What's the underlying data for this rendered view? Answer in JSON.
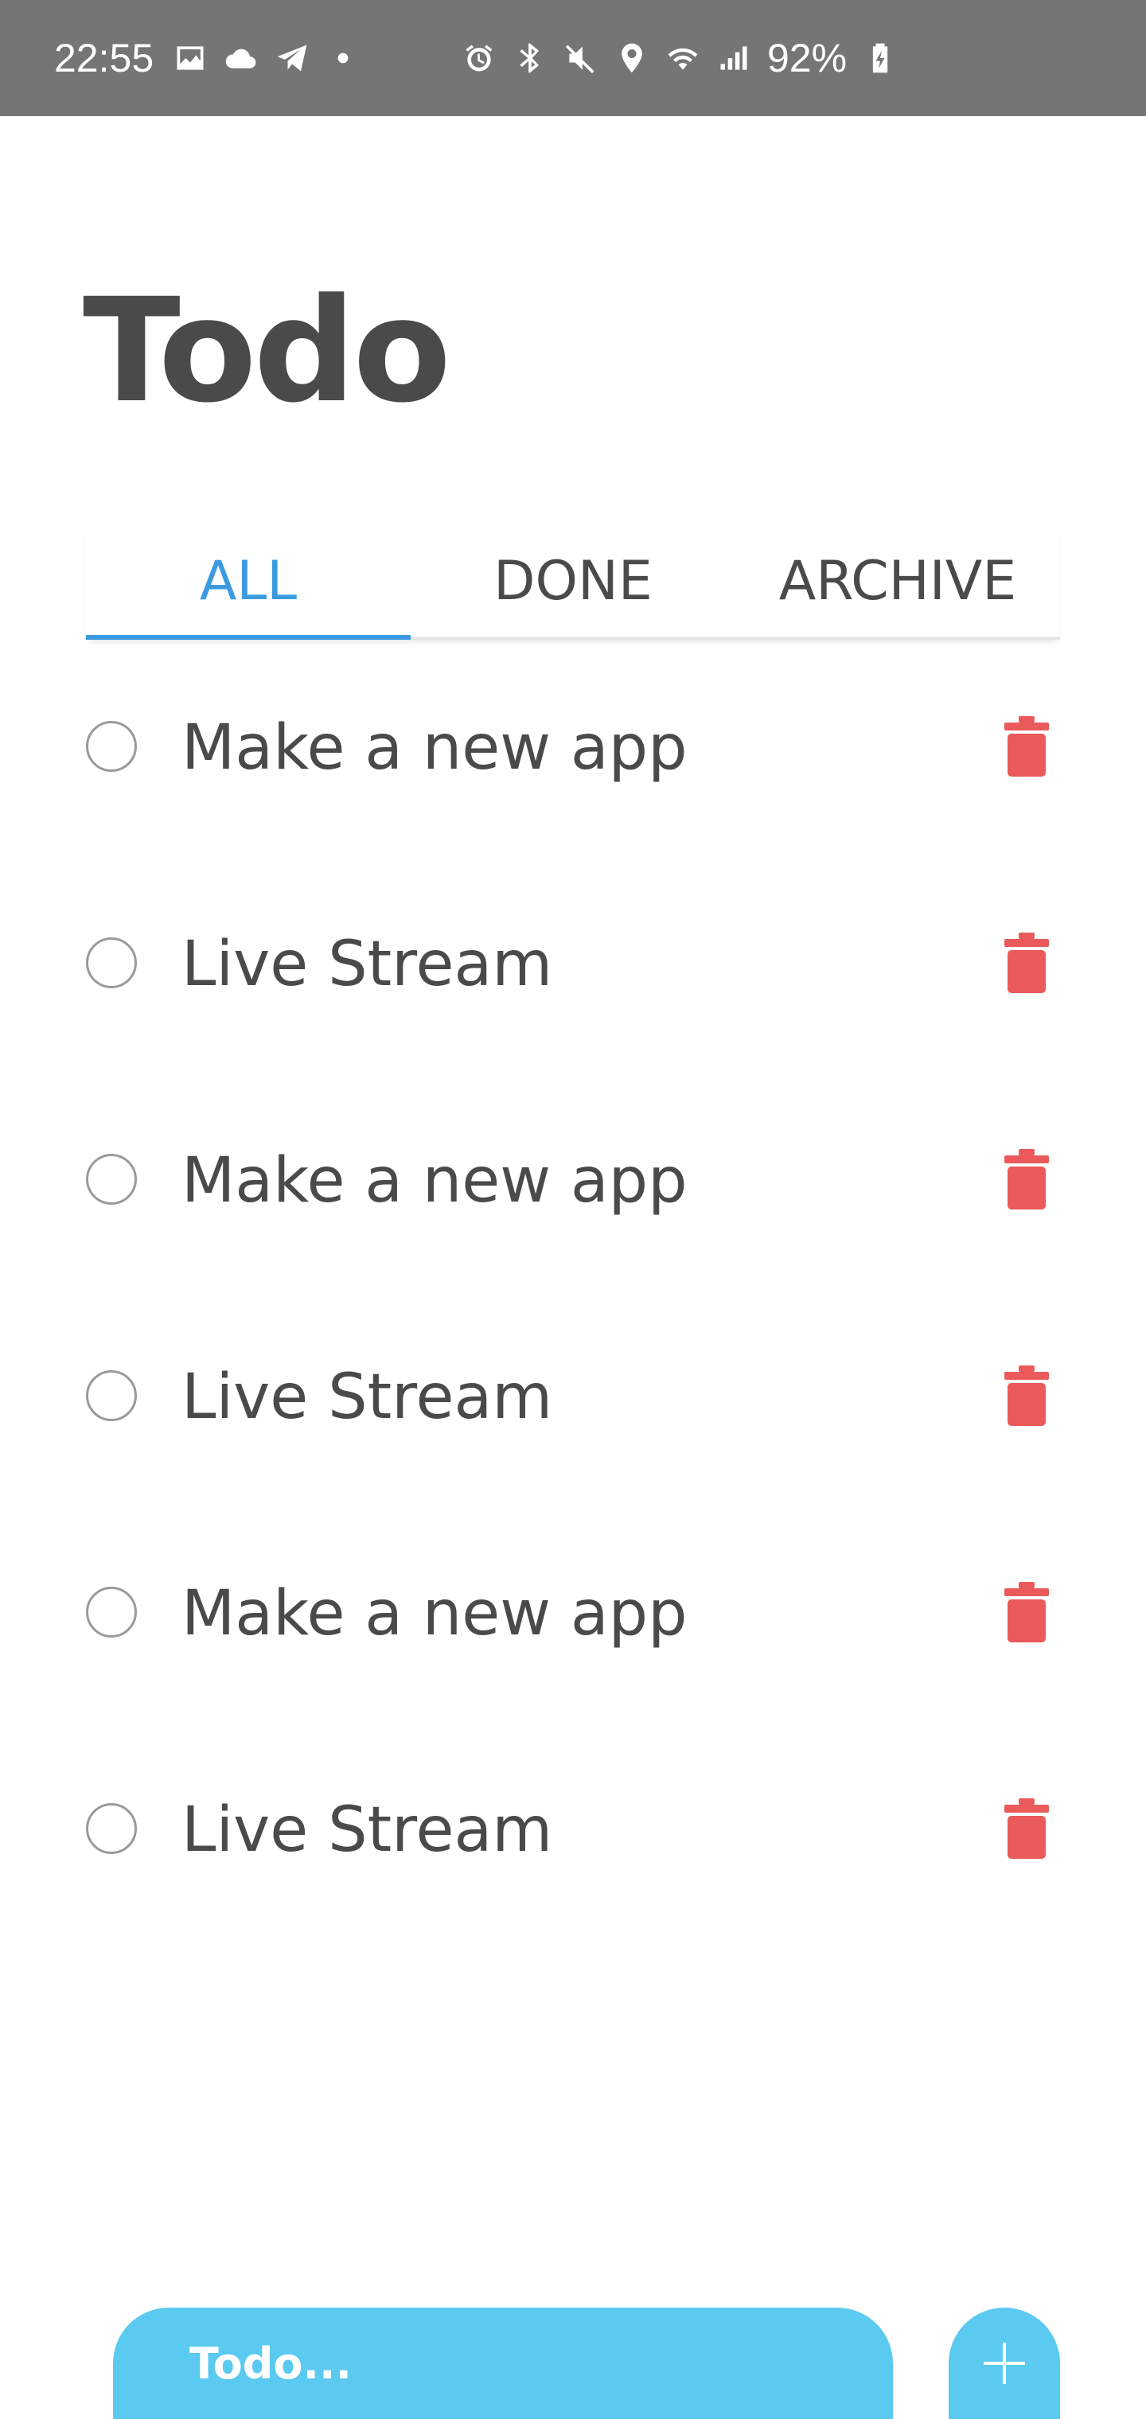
{
  "status_bar": {
    "time": "22:55",
    "battery": "92%",
    "left_icons": [
      "image-icon",
      "cloud-icon",
      "telegram-icon",
      "dot-icon"
    ],
    "right_icons": [
      "alarm-icon",
      "bluetooth-icon",
      "mute-icon",
      "location-icon",
      "wifi-icon",
      "signal-icon"
    ],
    "background_color": "#757575"
  },
  "header": {
    "title": "Todo"
  },
  "tabs": [
    {
      "label": "ALL",
      "active": true
    },
    {
      "label": "DONE",
      "active": false
    },
    {
      "label": "ARCHIVE",
      "active": false
    }
  ],
  "todos": [
    {
      "label": "Make a new app",
      "done": false
    },
    {
      "label": "Live Stream",
      "done": false
    },
    {
      "label": "Make a new app",
      "done": false
    },
    {
      "label": "Live Stream",
      "done": false
    },
    {
      "label": "Make a new app",
      "done": false
    },
    {
      "label": "Live Stream",
      "done": false
    }
  ],
  "input": {
    "placeholder": "Todo..."
  },
  "colors": {
    "accent": "#3b9be0",
    "input_background": "#5bcaf0",
    "delete": "#ea5a5a",
    "text": "#4a4a4a"
  }
}
